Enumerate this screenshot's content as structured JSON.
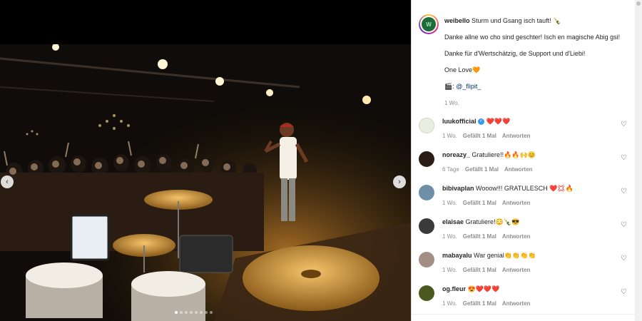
{
  "media": {
    "prev_icon": "chevron-left-icon",
    "next_icon": "chevron-right-icon",
    "prev_glyph": "‹",
    "next_glyph": "›",
    "dot_count": 8,
    "active_dot": 0
  },
  "post": {
    "username": "weibello",
    "avatar_letters": "W",
    "line1": "Sturm und Gsang isch tauft! 🍾",
    "line2": "Danke allne wo cho sind geschter! Isch en magische Abig gsi!",
    "line3": "Danke für d'Wertschätzig, de Support und d'Liebi!",
    "line4": "One Love🧡",
    "photo_credit_icon": "🎬:",
    "photo_credit": "@_flipit_",
    "time": "1 Wo."
  },
  "comments": [
    {
      "username": "luukofficial",
      "verified": true,
      "text": "❤️❤️❤️",
      "time": "1 Wo.",
      "likes": "Gefällt 1 Mal",
      "reply": "Antworten",
      "avatar_color": "#e8efe0"
    },
    {
      "username": "noreazy_",
      "verified": false,
      "text": "Gratuliere!!🔥🔥🙌😊",
      "time": "6 Tage",
      "likes": "Gefällt 1 Mal",
      "reply": "Antworten",
      "avatar_color": "#2b1d16"
    },
    {
      "username": "bibivaplan",
      "verified": false,
      "text": "Wooow!!! GRATULESCH ❤️💢🔥",
      "time": "1 Wo.",
      "likes": "Gefällt 1 Mal",
      "reply": "Antworten",
      "avatar_color": "#6d8fa8"
    },
    {
      "username": "elaisae",
      "verified": false,
      "text": "Gratuliere!😳🍾😎",
      "time": "1 Wo.",
      "likes": "Gefällt 1 Mal",
      "reply": "Antworten",
      "avatar_color": "#3a3a3a"
    },
    {
      "username": "mabayalu",
      "verified": false,
      "text": "War genial👏👏👏👏",
      "time": "1 Wo.",
      "likes": "Gefällt 1 Mal",
      "reply": "Antworten",
      "avatar_color": "#a38f86"
    },
    {
      "username": "og.fleur",
      "verified": false,
      "text": "😍❤️❤️❤️",
      "time": "1 Wo.",
      "likes": "Gefällt 1 Mal",
      "reply": "Antworten",
      "avatar_color": "#4a5a1e"
    }
  ],
  "heart_icon": "heart-outline-icon",
  "heart_glyph": "♡",
  "verified_glyph": "✓"
}
